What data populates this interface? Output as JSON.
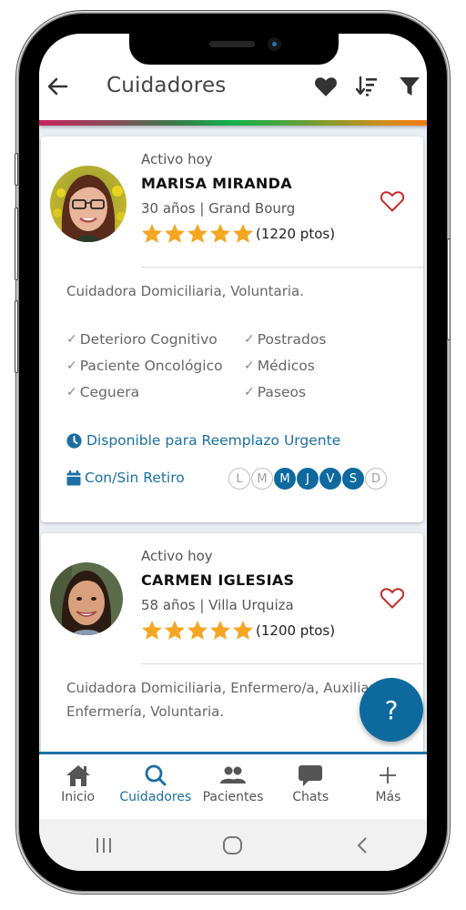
{
  "header": {
    "title": "Cuidadores",
    "icons": [
      "back-arrow-icon",
      "heart-icon",
      "sort-icon",
      "filter-icon"
    ]
  },
  "caregivers": [
    {
      "status": "Activo hoy",
      "name": "MARISA MIRANDA",
      "meta": "30 años | Grand Bourg",
      "rating": 5,
      "points": "(1220 ptos)",
      "description": "Cuidadora Domiciliaria, Voluntaria.",
      "skills": [
        "Deterioro Cognitivo",
        "Postrados",
        "Paciente Oncológico",
        "Médicos",
        "Ceguera",
        "Paseos"
      ],
      "availability": "Disponible para Reemplazo Urgente",
      "retiro": "Con/Sin Retiro",
      "days": [
        {
          "label": "L",
          "active": false
        },
        {
          "label": "M",
          "active": false
        },
        {
          "label": "M",
          "active": true
        },
        {
          "label": "J",
          "active": true
        },
        {
          "label": "V",
          "active": true
        },
        {
          "label": "S",
          "active": true
        },
        {
          "label": "D",
          "active": false
        }
      ]
    },
    {
      "status": "Activo hoy",
      "name": "CARMEN IGLESIAS",
      "meta": "58 años | Villa Urquiza",
      "rating": 5,
      "points": "(1200 ptos)",
      "description": "Cuidadora Domiciliaria, Enfermero/a, Auxiliar Enfermería, Voluntaria."
    }
  ],
  "fab": {
    "label": "?"
  },
  "bottom_nav": [
    {
      "label": "Inicio",
      "icon": "home-icon",
      "active": false
    },
    {
      "label": "Cuidadores",
      "icon": "search-icon",
      "active": true
    },
    {
      "label": "Pacientes",
      "icon": "people-icon",
      "active": false
    },
    {
      "label": "Chats",
      "icon": "chat-icon",
      "active": false
    },
    {
      "label": "Más",
      "icon": "plus-icon",
      "active": false
    }
  ],
  "colors": {
    "primary": "#1b6fa3",
    "day_active": "#0e6a9e",
    "star": "#f5a623",
    "heart_outline": "#c62828"
  }
}
